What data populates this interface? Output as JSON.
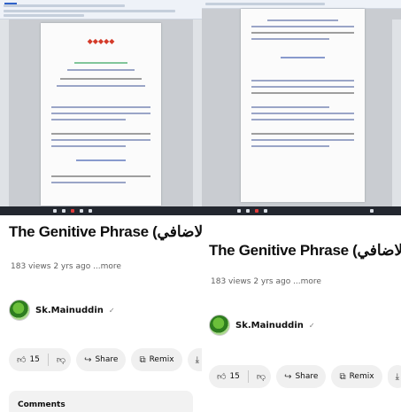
{
  "colors": {
    "title_red": "#d43b2a",
    "heading_green": "#1d9a4a",
    "heading_blue": "#2a4aa8",
    "taskbar": "#23272f",
    "chip_bg": "#f0f0f0",
    "meta_gray": "#606060"
  },
  "left": {
    "video_title": "The Genitive Phrase (المركب الاضافي)",
    "meta": "183 views  2 yrs ago  ...more",
    "channel_name": "Sk.Mainuddin",
    "verified_icon": "check-circle-icon",
    "likes": "15",
    "share_label": "Share",
    "remix_label": "Remix",
    "download_label": "Do",
    "comments_label": "Comments"
  },
  "right": {
    "video_title": "The Genitive Phrase (المركب الاضافي)",
    "meta": "183 views  2 yrs ago  ...more",
    "channel_name": "Sk.Mainuddin",
    "verified_icon": "check-circle-icon",
    "likes": "15",
    "share_label": "Share",
    "remix_label": "Remix"
  }
}
